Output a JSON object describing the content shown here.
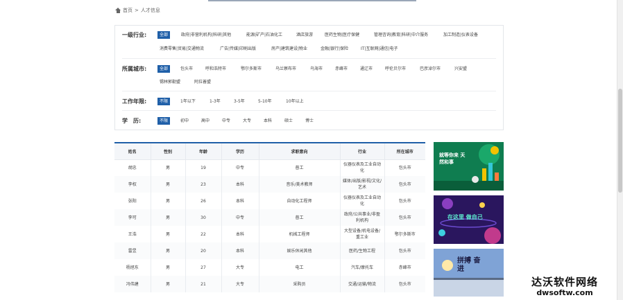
{
  "breadcrumb": {
    "home": "首页",
    "separator": ">",
    "current": "人才信息"
  },
  "filters": {
    "industry": {
      "label": "一级行业:",
      "options": [
        "全部",
        "政府|非营利机构|科研|其他",
        "能源|矿产|石油化工",
        "酒店旅游",
        "医药生物|医疗保健",
        "管理咨询|教育|科研|中介服务",
        "加工制造|仪表设备",
        "消费零售|贸易|交通物流",
        "广告|传媒|印刷出版",
        "房产|建筑建设|物业",
        "金融|银行|保险",
        "IT|互联网|通信|电子"
      ]
    },
    "city": {
      "label": "所属城市:",
      "options": [
        "全部",
        "包头市",
        "呼和浩特市",
        "鄂尔多斯市",
        "乌兰察布市",
        "乌海市",
        "赤峰市",
        "通辽市",
        "呼伦贝尔市",
        "巴彦淖尔市",
        "兴安盟",
        "锡林郭勒盟",
        "阿拉善盟"
      ]
    },
    "experience": {
      "label": "工作年限:",
      "options": [
        "不限",
        "1年以下",
        "1-3年",
        "3-5年",
        "5-10年",
        "10年以上"
      ]
    },
    "education": {
      "label": "学　历:",
      "options": [
        "不限",
        "初中",
        "高中",
        "中专",
        "大专",
        "本科",
        "硕士",
        "博士"
      ]
    }
  },
  "table": {
    "headers": [
      "姓名",
      "性别",
      "年龄",
      "学历",
      "求职意向",
      "行业",
      "所在城市"
    ],
    "rows": [
      [
        "胡忠",
        "男",
        "19",
        "中专",
        "普工",
        "仪器仪表及工业自动化",
        "包头市"
      ],
      [
        "李权",
        "男",
        "23",
        "本科",
        "音乐/美术教师",
        "媒体/出版/影视/文化/艺术",
        "包头市"
      ],
      [
        "张阳",
        "男",
        "26",
        "本科",
        "自动化工程师",
        "仪器仪表及工业自动化",
        "包头市"
      ],
      [
        "李可",
        "男",
        "30",
        "中专",
        "普工",
        "政府/公共事业/非盈利机构",
        "包头市"
      ],
      [
        "王浩",
        "男",
        "22",
        "本科",
        "机械工程师",
        "大型设备/机电设备/重工业",
        "鄂尔多斯市"
      ],
      [
        "雷昱",
        "男",
        "20",
        "本科",
        "娱乐休闲其他",
        "医药/生物工程",
        "包头市"
      ],
      [
        "杨旭东",
        "男",
        "27",
        "大专",
        "电工",
        "汽车/摩托车",
        "赤峰市"
      ],
      [
        "冯伟建",
        "男",
        "21",
        "大专",
        "采购员",
        "交通/运输/物流",
        "包头市"
      ]
    ]
  },
  "ads": {
    "ad1": "就等你来 天然和事",
    "ad2": "在这里 做自己",
    "ad3": "拼搏 奋进"
  },
  "watermark": {
    "cn": "达沃软件网络",
    "en": "dwsoftw.com"
  },
  "colors": {
    "accent": "#1f5fa8"
  }
}
